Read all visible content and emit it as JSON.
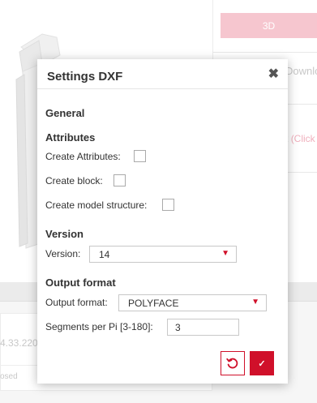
{
  "background": {
    "button_3d_label": "3D",
    "download_label": "Downloa",
    "click_text_dim": "t",
    "click_text_red": "(Click",
    "ip_text": "4.33.220",
    "closed_text": "osed"
  },
  "dialog": {
    "title": "Settings DXF",
    "close_glyph": "✖",
    "sections": {
      "general": "General",
      "attributes": "Attributes",
      "version": "Version",
      "output_format": "Output format"
    },
    "fields": {
      "create_attributes": {
        "label": "Create Attributes:",
        "checked": false
      },
      "create_block": {
        "label": "Create block:",
        "checked": false
      },
      "create_model_structure": {
        "label": "Create model structure:",
        "checked": false
      },
      "version": {
        "label": "Version:",
        "value": "14"
      },
      "output_format": {
        "label": "Output format:",
        "value": "POLYFACE"
      },
      "segments": {
        "label": "Segments per Pi [3-180]:",
        "value": "3"
      }
    },
    "buttons": {
      "reset_icon": "reset-icon",
      "ok_glyph": "✓"
    }
  },
  "colors": {
    "accent": "#d0102a",
    "accent_faded": "#f6c6cf"
  }
}
